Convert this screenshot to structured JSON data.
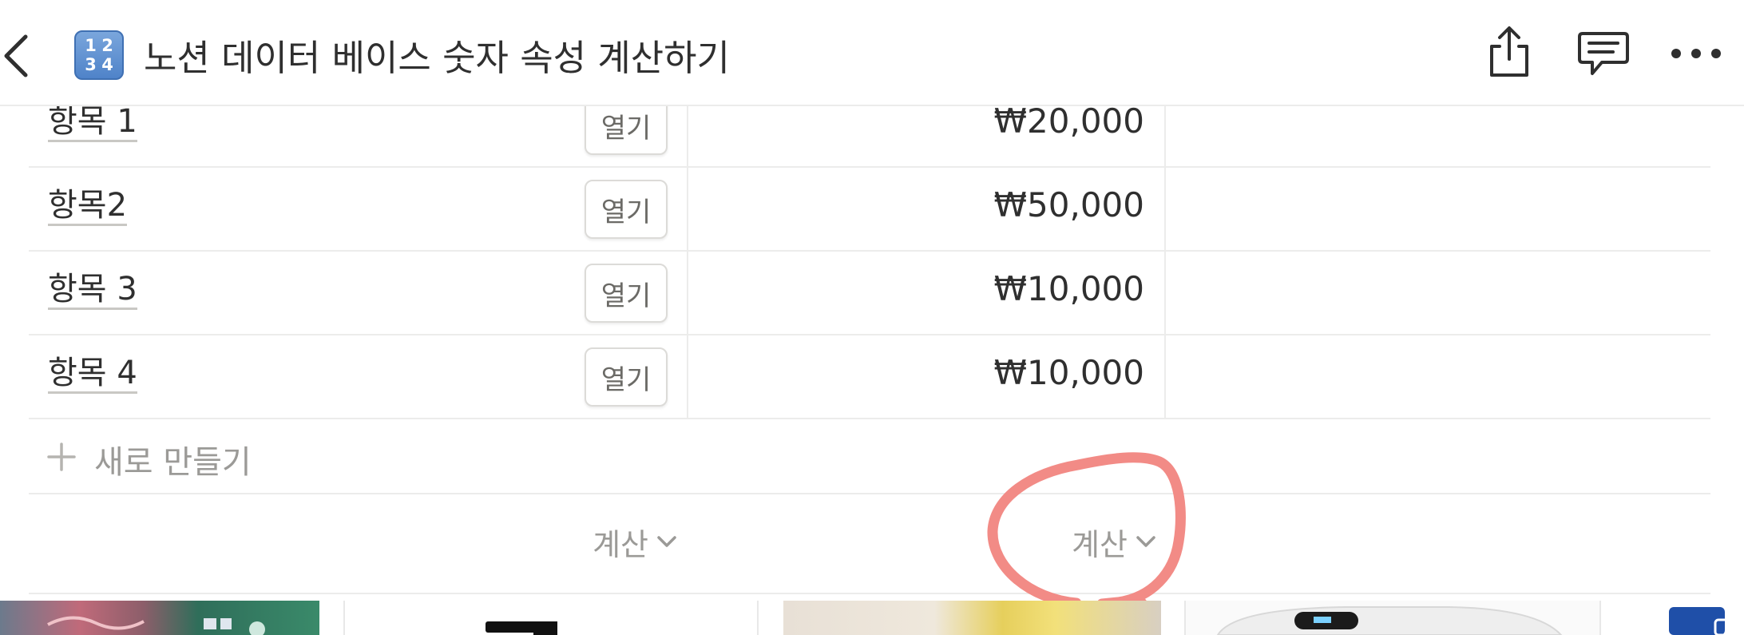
{
  "header": {
    "title": "노션 데이터 베이스 숫자 속성 계산하기",
    "emoji_digits": [
      "1",
      "2",
      "3",
      "4"
    ],
    "icons": {
      "back": "chevron-left-icon",
      "share": "share-icon",
      "comment": "comment-icon",
      "more": "more-horizontal-icon"
    }
  },
  "table": {
    "rows": [
      {
        "name": "항목 1",
        "open_label": "열기",
        "amount": "₩20,000"
      },
      {
        "name": "항목2",
        "open_label": "열기",
        "amount": "₩50,000"
      },
      {
        "name": "항목 3",
        "open_label": "열기",
        "amount": "₩10,000"
      },
      {
        "name": "항목 4",
        "open_label": "열기",
        "amount": "₩10,000"
      }
    ],
    "new_row_label": "새로 만들기",
    "calculate": [
      {
        "label": "계산"
      },
      {
        "label": "계산"
      }
    ]
  },
  "annotation": {
    "color": "#f28b86",
    "shape": "hand-drawn circle around calculate button"
  },
  "colors": {
    "text": "#2f2f2f",
    "muted": "#9b9a97",
    "border": "#ececeb",
    "emoji_blue": "#4f83c9"
  }
}
